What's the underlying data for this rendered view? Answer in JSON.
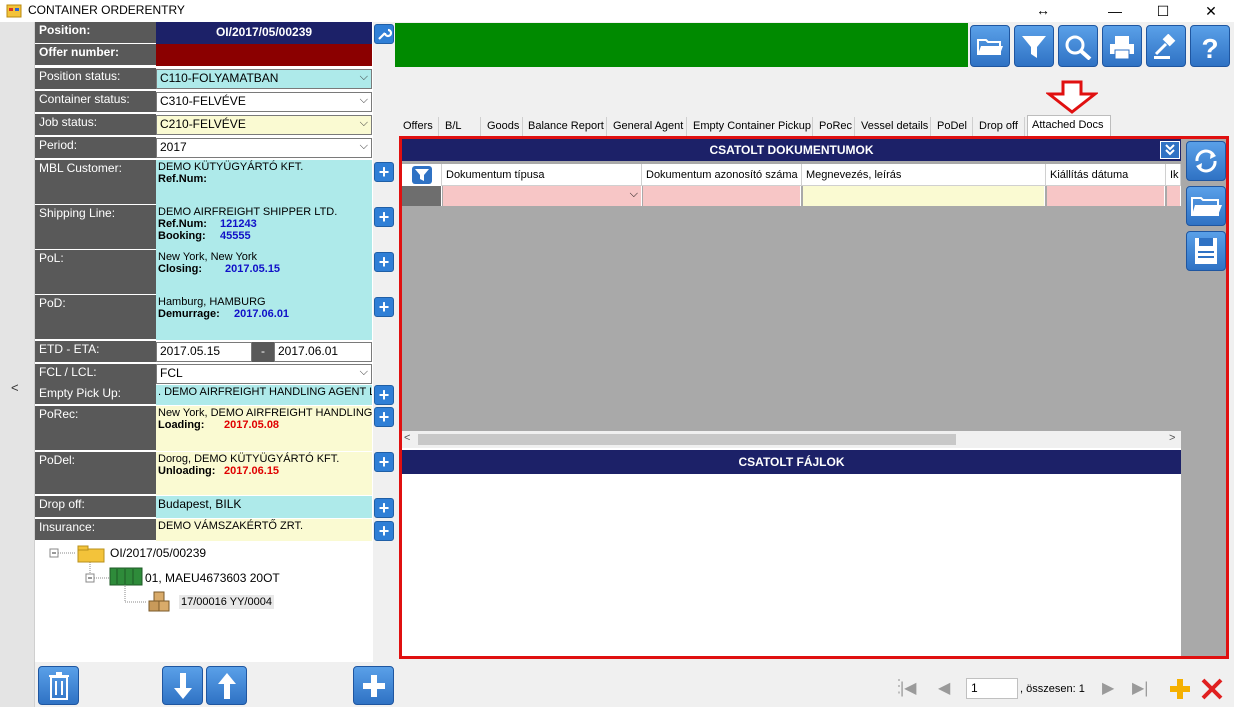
{
  "window": {
    "title": "CONTAINER ORDERENTRY",
    "controls": {
      "resize": "↔",
      "minimize": "—",
      "maximize": "☐",
      "close": "✕"
    }
  },
  "left": {
    "collapse_label": "<",
    "position_label": "Position:",
    "position_value": "OI/2017/05/00239",
    "offer_label": "Offer number:",
    "offer_value": "",
    "position_status_label": "Position status:",
    "position_status_value": "C110-FOLYAMATBAN",
    "container_status_label": "Container status:",
    "container_status_value": "C310-FELVÉVE",
    "job_status_label": "Job status:",
    "job_status_value": "C210-FELVÉVE",
    "period_label": "Period:",
    "period_value": "2017",
    "mbl_label": "MBL Customer:",
    "mbl_name": "DEMO KÜTYÜGYÁRTÓ KFT.",
    "mbl_ref_label": "Ref.Num:",
    "mbl_ref_value": "",
    "shipping_label": "Shipping Line:",
    "shipping_name": "DEMO AIRFREIGHT SHIPPER LTD.",
    "shipping_ref_label": "Ref.Num:",
    "shipping_ref_value": "121243",
    "shipping_booking_label": "Booking:",
    "shipping_booking_value": "45555",
    "pol_label": "PoL:",
    "pol_name": "New York, New York",
    "pol_closing_label": "Closing:",
    "pol_closing_value": "2017.05.15",
    "pod_label": "PoD:",
    "pod_name": "Hamburg, HAMBURG",
    "pod_demurrage_label": "Demurrage:",
    "pod_demurrage_value": "2017.06.01",
    "etd_label": "ETD - ETA:",
    "etd_value": "2017.05.15",
    "eta_sep": "-",
    "eta_value": "2017.06.01",
    "fcl_label": "FCL / LCL:",
    "fcl_value": "FCL",
    "empty_label": "Empty Pick Up:",
    "empty_value": ". DEMO AIRFREIGHT HANDLING AGENT LTD.",
    "porec_label": "PoRec:",
    "porec_name": "New York, DEMO AIRFREIGHT HANDLING AG",
    "porec_loading_label": "Loading:",
    "porec_loading_value": "2017.05.08",
    "podel_label": "PoDel:",
    "podel_name": "Dorog, DEMO KÜTYÜGYÁRTÓ KFT.",
    "podel_unloading_label": "Unloading:",
    "podel_unloading_value": "2017.06.15",
    "dropoff_label": "Drop off:",
    "dropoff_value": "Budapest, BILK",
    "insurance_label": "Insurance:",
    "insurance_value": "DEMO VÁMSZAKÉRTŐ ZRT.",
    "tree": {
      "root": "OI/2017/05/00239",
      "container": "01, MAEU4673603 20OT",
      "item": "17/00016 YY/0004"
    }
  },
  "tabs": [
    "Offers",
    "B/L",
    "Goods",
    "Balance Report",
    "General Agent",
    "Empty Container Pickup",
    "PoRec",
    "Vessel details",
    "PoDel",
    "Drop off",
    "Attached Docs"
  ],
  "active_tab": "Attached Docs",
  "docs": {
    "title": "CSATOLT DOKUMENTUMOK",
    "columns": [
      "Dokumentum típusa",
      "Dokumentum azonosító száma",
      "Megnevezés, leírás",
      "Kiállítás dátuma",
      "Ik"
    ]
  },
  "files": {
    "title": "CSATOLT FÁJLOK"
  },
  "pager": {
    "page": "1",
    "total_text": ", összesen: 1"
  },
  "colors": {
    "header_navy": "#1c2168",
    "label_gray": "#595959",
    "cyan": "#aeeaea",
    "yellow": "#fafad2",
    "pink": "#f7c6c6",
    "accent_blue": "#2f72c4",
    "frame_red": "#e01010",
    "green_bar": "#008a00"
  }
}
